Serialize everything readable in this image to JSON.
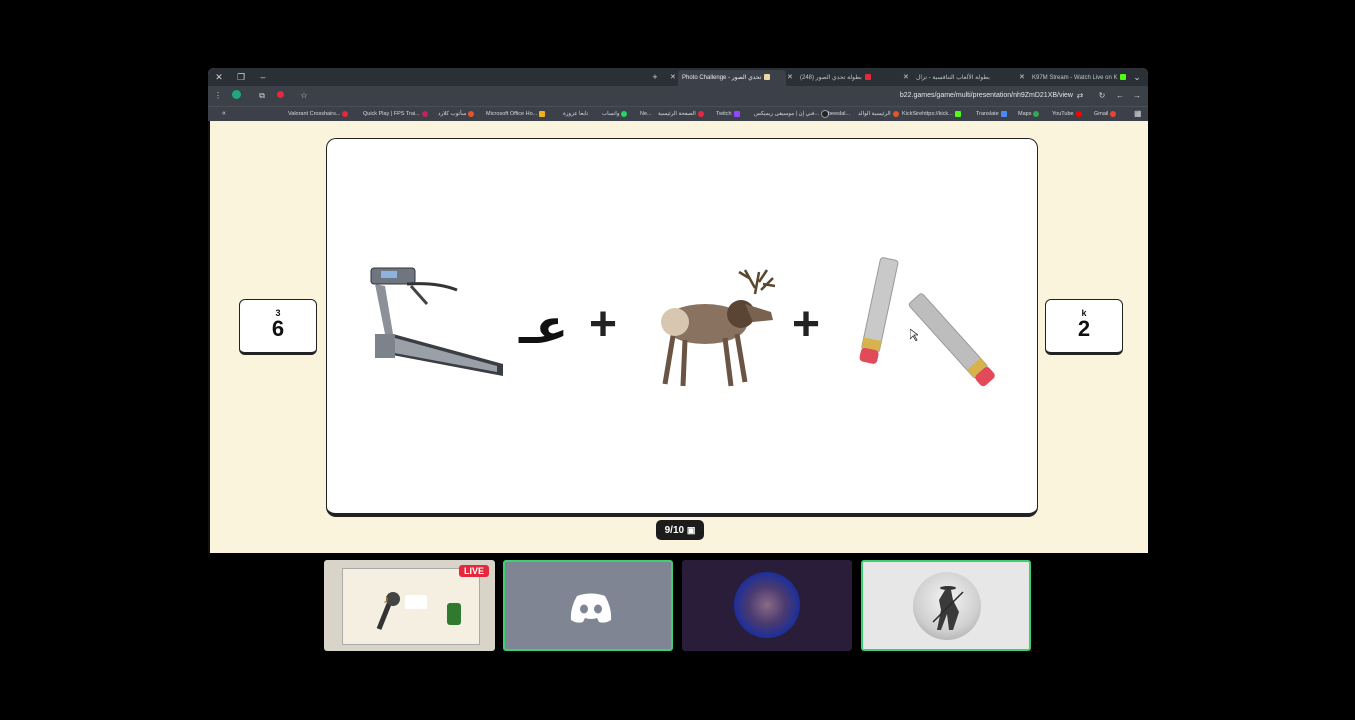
{
  "browser": {
    "tabs": [
      {
        "title": "Photo Challenge - تحدي الصور",
        "active": true
      },
      {
        "title": "بطولة تحدي الصور (248)",
        "active": false
      },
      {
        "title": "بطولة الألعاب التنافسية - تزال",
        "active": false
      },
      {
        "title": "K97M Stream - Watch Live on K",
        "active": false
      }
    ],
    "url": "b22.games/game/multi/presentation/nh9ZmD21XB/view",
    "bookmarks": [
      "Valorant Crosshairs...",
      "Quick Play | FPS Trai...",
      "سأتوب كلارد",
      "Microsoft Office Ho...",
      "تابعا عزوزة",
      "واتساب",
      "Ne...",
      "الصفحة الرئيسية",
      "Twitch",
      "فني إن | موسيقى ريميكس...",
      "beeslal...",
      "الرئيسية الوالد",
      "KickSirehttps://kick...",
      "Translate",
      "Maps",
      "YouTube",
      "Gmail"
    ]
  },
  "game": {
    "left_score": {
      "small": "3",
      "big": "6"
    },
    "right_score": {
      "small": "k",
      "big": "2"
    },
    "puzzle_letter": "عـ",
    "plus_sign": "+",
    "counter": "9/10"
  },
  "call": {
    "live_badge": "LIVE"
  },
  "colors": {
    "page_bg": "#fbf4dc",
    "tile_active_border": "#3ecf73",
    "discord_blue": "#5865f2",
    "live_red": "#e5283d"
  }
}
